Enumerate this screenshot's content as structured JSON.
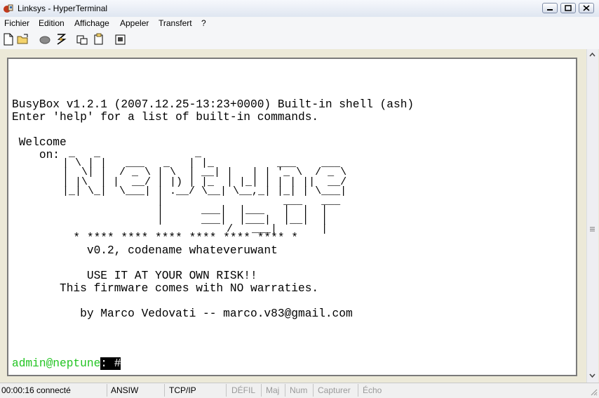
{
  "window": {
    "title": "Linksys - HyperTerminal"
  },
  "menu": [
    "Fichier",
    "Edition",
    "Affichage",
    "Appeler",
    "Transfert",
    "?"
  ],
  "toolbar": {
    "icons": [
      "new-icon",
      "open-icon",
      "disconnect-icon",
      "dial-icon",
      "properties-send-icon",
      "receive-icon",
      "properties-icon"
    ]
  },
  "terminal": {
    "lines": [
      "BusyBox v1.2.1 (2007.12.25-13:23+0000) Built-in shell (ash)",
      "Enter 'help' for a list of built-in commands.",
      " Welcome",
      "    on:"
    ],
    "banner_art": "         _   _               _\n        | \\ | |   ___   _   | |_          ___    ___\n        |  \\| |  / _ \\ | \\  | __| |   | | '_ \\  / _ \\\n        | |\\  | |  __/ | |) | |_  | |_| | | | ||  __/\n        |_| \\_|  \\___| | .__/ \\__| \\__,_| |_| | \\___|\n                       |                   ___   ___\n                       |      ___|  |___   |  |  |\n                       |      ___|  |___|  |__|  |\n                                  /   ___|       |",
    "stars": "         * **** **** **** **** **** **** *",
    "version": "           v0.2, codename whateveruwant",
    "risk": "           USE IT AT YOUR OWN RISK!!",
    "warranty": "       This firmware comes with NO warraties.",
    "author": "          by Marco Vedovati -- marco.v83@gmail.com",
    "prompt_user": "admin@neptune",
    "prompt_rest": ": #"
  },
  "status": {
    "time": "00:00:16 connecté",
    "emulation": "ANSIW",
    "protocol": "TCP/IP",
    "scroll": "DÉFIL",
    "caps": "Maj",
    "num": "Num",
    "capture": "Capturer",
    "echo": "Écho"
  },
  "colors": {
    "prompt": "#22c422",
    "cursor_bg": "#000000"
  }
}
